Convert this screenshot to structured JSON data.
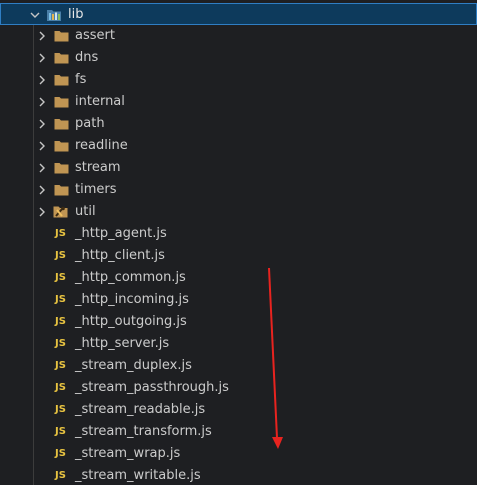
{
  "explorer": {
    "root": {
      "label": "lib",
      "expanded": true,
      "icon": "library-folder-icon"
    },
    "folders": [
      {
        "label": "assert",
        "icon": "folder-icon"
      },
      {
        "label": "dns",
        "icon": "folder-icon"
      },
      {
        "label": "fs",
        "icon": "folder-icon"
      },
      {
        "label": "internal",
        "icon": "folder-icon"
      },
      {
        "label": "path",
        "icon": "folder-icon"
      },
      {
        "label": "readline",
        "icon": "folder-icon"
      },
      {
        "label": "stream",
        "icon": "folder-icon"
      },
      {
        "label": "timers",
        "icon": "folder-icon"
      },
      {
        "label": "util",
        "icon": "tools-folder-icon"
      }
    ],
    "js_badge": "JS",
    "files": [
      {
        "label": "_http_agent.js"
      },
      {
        "label": "_http_client.js"
      },
      {
        "label": "_http_common.js"
      },
      {
        "label": "_http_incoming.js"
      },
      {
        "label": "_http_outgoing.js"
      },
      {
        "label": "_http_server.js"
      },
      {
        "label": "_stream_duplex.js"
      },
      {
        "label": "_stream_passthrough.js"
      },
      {
        "label": "_stream_readable.js"
      },
      {
        "label": "_stream_transform.js"
      },
      {
        "label": "_stream_wrap.js"
      },
      {
        "label": "_stream_writable.js"
      }
    ]
  },
  "colors": {
    "background": "#1e1f22",
    "selected_row": "#0d3a5c",
    "selected_border": "#2f7ec4",
    "folder": "#c09553",
    "js_badge": "#e8c341",
    "annotation_arrow": "#e8231f"
  }
}
